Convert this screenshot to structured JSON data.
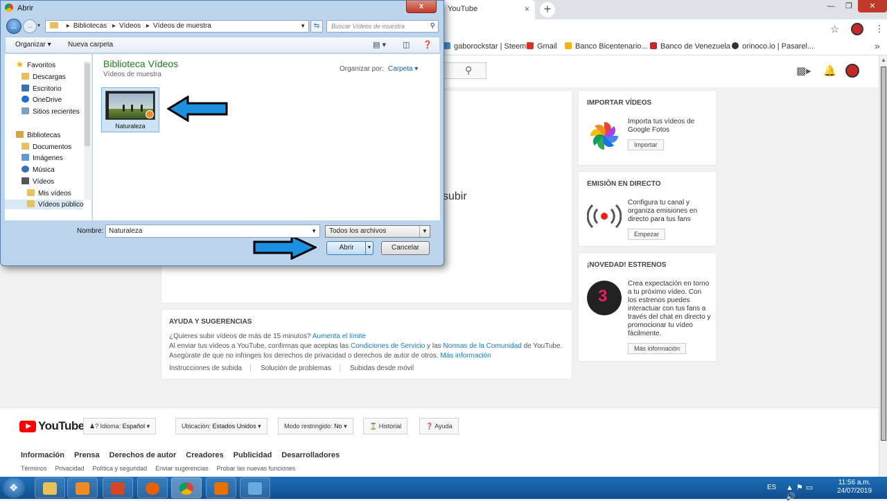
{
  "browser": {
    "tab_title": "YouTube",
    "tab_close": "×",
    "new_tab": "+",
    "bookmarks": [
      {
        "label": "gaborockstar | Steem",
        "color": "#4a90d9"
      },
      {
        "label": "Gmail",
        "color": "#d93025"
      },
      {
        "label": "Banco Bicentenario...",
        "color": "#f4b400"
      },
      {
        "label": "Banco de Venezuela",
        "color": "#c62828"
      },
      {
        "label": "orinoco.io | Pasarel...",
        "color": "#333333"
      }
    ],
    "more": "»"
  },
  "dialog": {
    "title": "Abrir",
    "close": "x",
    "breadcrumb": [
      "Bibliotecas",
      "Vídeos",
      "Vídeos de muestra"
    ],
    "search_placeholder": "Buscar Vídeos de muestra",
    "toolbar": {
      "organize": "Organizar ▾",
      "new_folder": "Nueva carpeta"
    },
    "nav": [
      {
        "label": "Favoritos",
        "icon": "star-icon",
        "color": "#f4b400",
        "indent": 0,
        "top": 0
      },
      {
        "label": "Descargas",
        "icon": "folder-icon",
        "color": "#e8c15a",
        "indent": 1
      },
      {
        "label": "Escritorio",
        "icon": "desktop-icon",
        "color": "#3b6fb6",
        "indent": 1
      },
      {
        "label": "OneDrive",
        "icon": "cloud-icon",
        "color": "#1e6fd0",
        "indent": 1
      },
      {
        "label": "Sitios recientes",
        "icon": "recent-icon",
        "color": "#7aa0c8",
        "indent": 1
      },
      {
        "label": "Bibliotecas",
        "icon": "library-icon",
        "color": "#d9a441",
        "indent": 0
      },
      {
        "label": "Documentos",
        "icon": "folder-icon",
        "color": "#e8c15a",
        "indent": 1
      },
      {
        "label": "Imágenes",
        "icon": "folder-icon",
        "color": "#5a9bd5",
        "indent": 1
      },
      {
        "label": "Música",
        "icon": "music-icon",
        "color": "#3b6fb6",
        "indent": 1
      },
      {
        "label": "Vídeos",
        "icon": "video-folder-icon",
        "color": "#555555",
        "indent": 1
      },
      {
        "label": "Mis vídeos",
        "icon": "folder-icon",
        "color": "#e8c15a",
        "indent": 2
      },
      {
        "label": "Vídeos público",
        "icon": "folder-icon",
        "color": "#e8c15a",
        "indent": 2,
        "selected": true
      }
    ],
    "library_title": "Biblioteca Vídeos",
    "library_subtitle": "Vídeos de muestra",
    "arrange_label": "Organizar por:",
    "arrange_value": "Carpeta ▾",
    "file": {
      "name": "Naturaleza"
    },
    "filename_label": "Nombre:",
    "filename_value": "Naturaleza",
    "file_type": "Todos los archivos",
    "open_button": "Abrir",
    "cancel_button": "Cancelar"
  },
  "youtube": {
    "partial_text": "subir",
    "cards": [
      {
        "title": "IMPORTAR VÍDEOS",
        "text": "Importa tus vídeos de Google Fotos",
        "button": "Importar"
      },
      {
        "title": "EMISIÓN EN DIRECTO",
        "text": "Configura tu canal y organiza emisiones en directo para tus fans",
        "button": "Empezar"
      },
      {
        "title": "¡NOVEDAD! ESTRENOS",
        "text": "Crea expectación en torno a tu próximo vídeo. Con los estrenos puedes interactuar con tus fans a través del chat en directo y promocionar tu vídeo fácilmente.",
        "button": "Más información",
        "badge": "3"
      }
    ],
    "help": {
      "title": "AYUDA Y SUGERENCIAS",
      "line1_a": "¿Quieres subir vídeos de más de 15 minutos?",
      "line1_link": "Aumenta el límite",
      "line2_a": "Al enviar tus vídeos a YouTube, confirmas que aceptas las",
      "line2_link1": "Condiciones de Servicio",
      "line2_b": "y las",
      "line2_link2": "Normas de la Comunidad",
      "line2_c": "de YouTube.",
      "line3_a": "Asegúrate de que no infringes los derechos de privacidad o derechos de autor de otros.",
      "line3_link": "Más información",
      "links": [
        "Instrucciones de subida",
        "Solución de problemas",
        "Subidas desde móvil"
      ]
    },
    "footer": {
      "logo": "YouTube",
      "language_label": "Idioma:",
      "language_value": "Español",
      "location_label": "Ubicación:",
      "location_value": "Estados Unidos",
      "restricted_label": "Modo restringido:",
      "restricted_value": "No",
      "history": "Historial",
      "help": "Ayuda",
      "links1": [
        "Información",
        "Prensa",
        "Derechos de autor",
        "Creadores",
        "Publicidad",
        "Desarrolladores"
      ],
      "links2": [
        "Términos",
        "Privacidad",
        "Política y seguridad",
        "Enviar sugerencias",
        "Probar las nuevas funciones"
      ]
    }
  },
  "taskbar": {
    "apps": [
      {
        "name": "explorer-icon",
        "color": "#e8c15a"
      },
      {
        "name": "media-player-icon",
        "color": "#f08a24"
      },
      {
        "name": "powerpoint-icon",
        "color": "#d24726"
      },
      {
        "name": "firefox-icon",
        "color": "#e66000"
      },
      {
        "name": "chrome-icon",
        "color": "#0f9d58"
      },
      {
        "name": "java-icon",
        "color": "#e76f00"
      },
      {
        "name": "paint-icon",
        "color": "#6aa8e0"
      }
    ],
    "language": "ES",
    "time": "11:56 a.m.",
    "date": "24/07/2019"
  }
}
